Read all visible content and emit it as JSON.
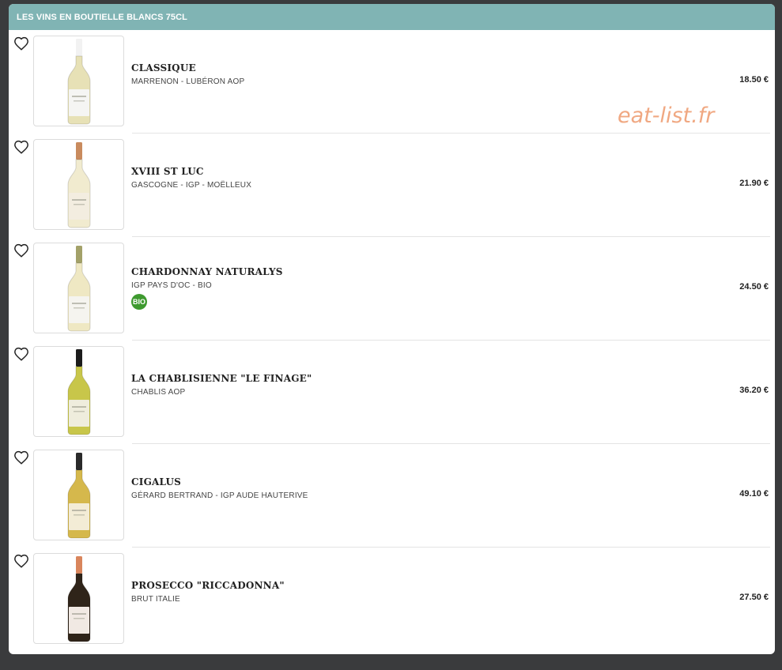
{
  "header": {
    "title": "LES VINS EN BOUTIELLE BLANCS 75CL"
  },
  "watermark": "eat-list.fr",
  "items": [
    {
      "name": "CLASSIQUE",
      "desc": "MARRENON - LUBÉRON AOP",
      "price": "18.50 €",
      "bottle": {
        "glass": "#e7e1b6",
        "cap": "#f2f2f2",
        "label": "#f5f5f3"
      }
    },
    {
      "name": "XVIII ST LUC",
      "desc": "GASCOGNE - IGP - MOËLLEUX",
      "price": "21.90 €",
      "bottle": {
        "glass": "#f1ebcf",
        "cap": "#c98b5e",
        "label": "#f3ede0"
      }
    },
    {
      "name": "CHARDONNAY NATURALYS",
      "desc": "IGP PAYS D'OC - BIO",
      "price": "24.50 €",
      "badge": "BIO",
      "bottle": {
        "glass": "#efe8c3",
        "cap": "#a3a169",
        "label": "#f5f4ef"
      }
    },
    {
      "name": "LA CHABLISIENNE \"LE FINAGE\"",
      "desc": "CHABLIS AOP",
      "price": "36.20 €",
      "bottle": {
        "glass": "#c8c64a",
        "cap": "#1c1c1c",
        "label": "#efeddd"
      }
    },
    {
      "name": "CIGALUS",
      "desc": "GÉRARD BERTRAND - IGP AUDE HAUTERIVE",
      "price": "49.10 €",
      "bottle": {
        "glass": "#d5b84c",
        "cap": "#2a2a2a",
        "label": "#f3ecd6"
      }
    },
    {
      "name": "PROSECCO \"RICCADONNA\"",
      "desc": "BRUT ITALIE",
      "price": "27.50 €",
      "bottle": {
        "glass": "#2f2419",
        "cap": "#d9855c",
        "label": "#f1e9e3"
      }
    }
  ]
}
